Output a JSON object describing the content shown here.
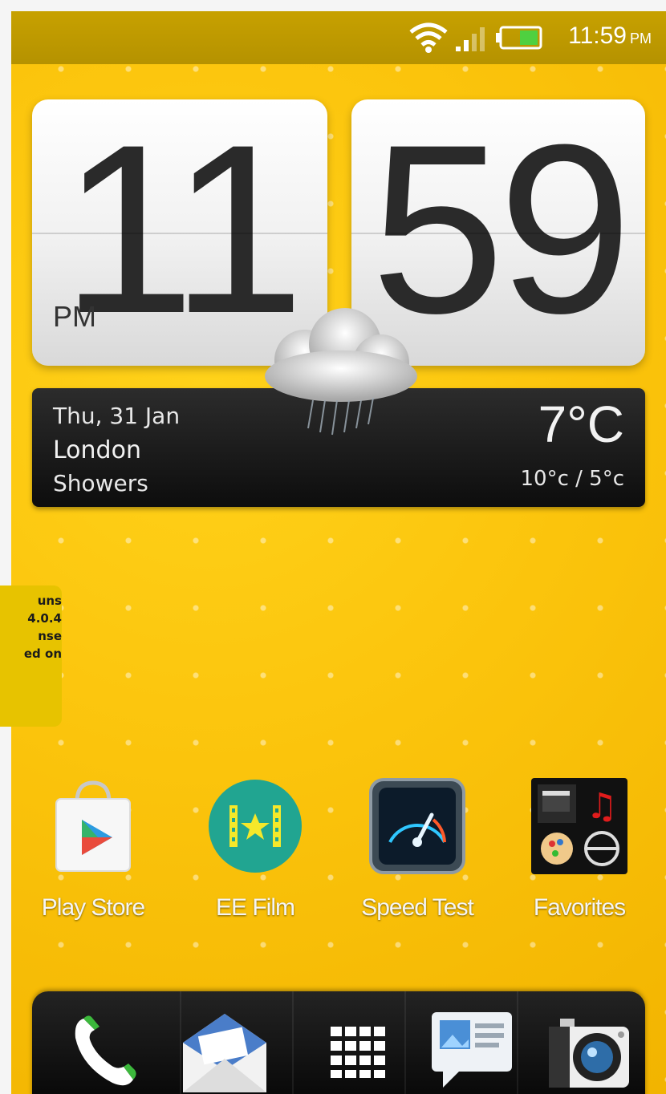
{
  "status_bar": {
    "time": "11:59",
    "ampm": "PM",
    "icons": [
      "wifi-icon",
      "signal-icon",
      "battery-icon"
    ]
  },
  "clock": {
    "hour": "11",
    "minute": "59",
    "ampm": "PM"
  },
  "weather": {
    "date": "Thu, 31 Jan",
    "city": "London",
    "condition": "Showers",
    "temperature": "7°C",
    "range": "10°c / 5°c",
    "icon": "cloud-rain-icon"
  },
  "apps": [
    {
      "label": "Play Store",
      "icon": "play-store-icon"
    },
    {
      "label": "EE Film",
      "icon": "film-icon"
    },
    {
      "label": "Speed Test",
      "icon": "speedometer-icon"
    },
    {
      "label": "Favorites",
      "icon": "favorites-folder-icon"
    }
  ],
  "dock": {
    "items": [
      "phone-icon",
      "mail-icon",
      "app-drawer-icon",
      "messages-icon",
      "camera-icon"
    ]
  },
  "caption": {
    "text": "uns\n4.0.4\nnse\ned on"
  },
  "colors": {
    "wallpaper": "#fbc40c",
    "status_bar": "#b59200",
    "dock": "#111111",
    "weather_bar": "#1a1a1a"
  }
}
